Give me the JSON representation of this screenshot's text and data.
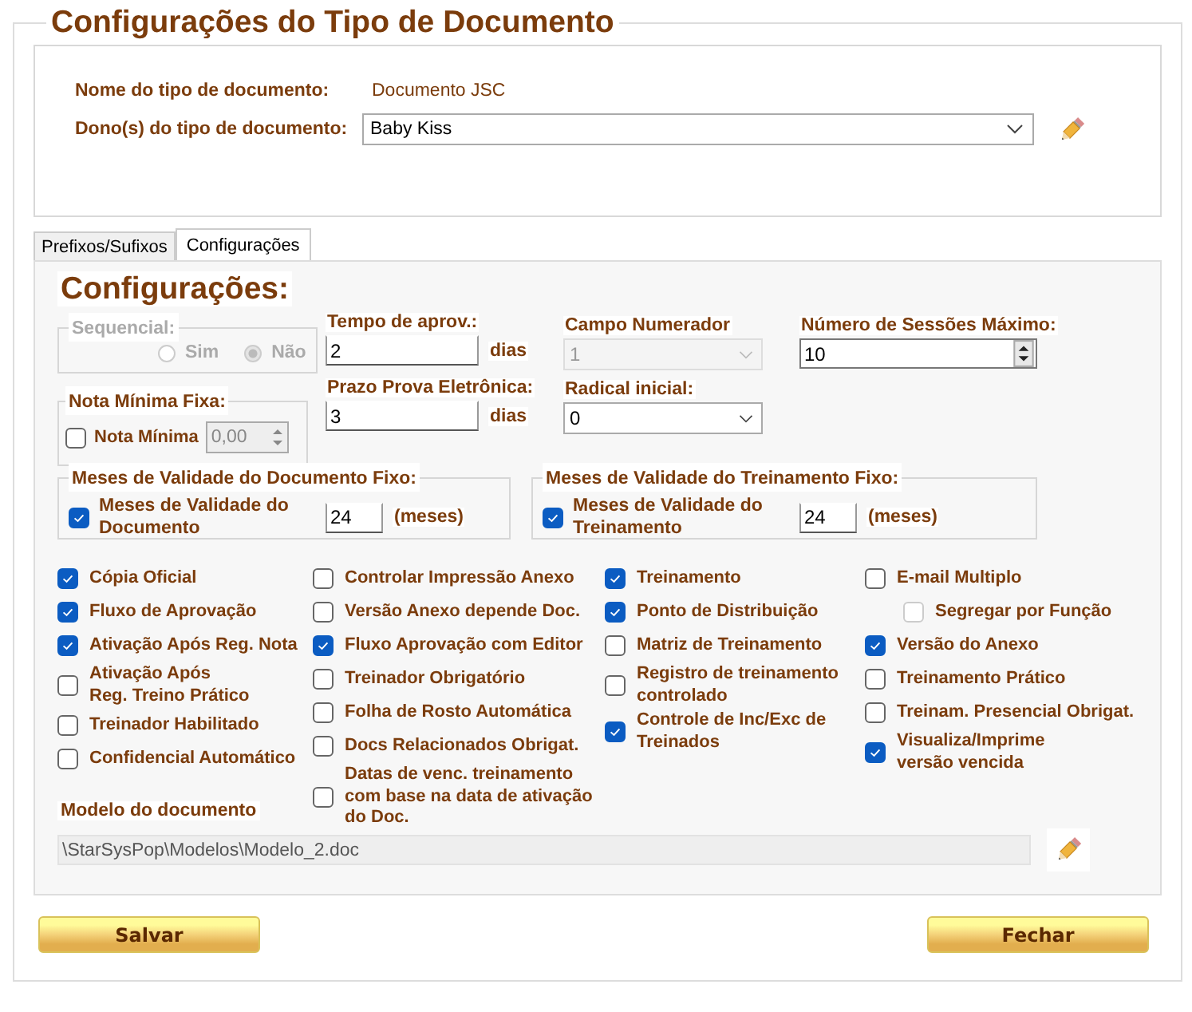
{
  "title": "Configurações do Tipo de Documento",
  "header": {
    "name_label": "Nome do tipo de documento:",
    "name_value": "Documento JSC",
    "owner_label": "Dono(s) do tipo de documento:",
    "owner_value": "Baby Kiss"
  },
  "tabs": [
    {
      "label": "Prefixos/Sufixos",
      "selected": false
    },
    {
      "label": "Configurações",
      "selected": true
    }
  ],
  "section_title": "Configurações:",
  "sequencial": {
    "legend": "Sequencial:",
    "disabled": true,
    "options": [
      {
        "label": "Sim",
        "selected": false
      },
      {
        "label": "Não",
        "selected": true
      }
    ]
  },
  "nota_minima": {
    "legend": "Nota Mínima Fixa:",
    "label": "Nota Mínima",
    "checked": false,
    "value": "0,00"
  },
  "tempo_aprov": {
    "label": "Tempo de aprov.:",
    "value": "2",
    "unit": "dias"
  },
  "prazo_prova": {
    "label": "Prazo Prova Eletrônica:",
    "value": "3",
    "unit": "dias"
  },
  "campo_numerador": {
    "label": "Campo Numerador",
    "value": "1",
    "disabled": true
  },
  "radical_inicial": {
    "label": "Radical inicial:",
    "value": "0",
    "disabled": false
  },
  "numero_sessoes": {
    "label": "Número de Sessões Máximo:",
    "value": "10"
  },
  "validity_groups": [
    {
      "legend": "Meses de Validade do Documento Fixo:",
      "label": "Meses de Validade do\nDocumento",
      "checked": true,
      "value": "24",
      "unit": "(meses)"
    },
    {
      "legend": "Meses de Validade do Treinamento Fixo:",
      "label": "Meses de Validade do\nTreinamento",
      "checked": true,
      "value": "24",
      "unit": "(meses)"
    }
  ],
  "option_columns": [
    [
      {
        "label": "Cópia Oficial",
        "checked": true
      },
      {
        "label": "Fluxo de Aprovação",
        "checked": true
      },
      {
        "label": "Ativação Após Reg. Nota",
        "checked": true
      },
      {
        "label": "Ativação Após\nReg. Treino Prático",
        "checked": false
      },
      {
        "label": "Treinador Habilitado",
        "checked": false
      },
      {
        "label": "Confidencial Automático",
        "checked": false
      }
    ],
    [
      {
        "label": "Controlar Impressão Anexo",
        "checked": false
      },
      {
        "label": "Versão Anexo depende Doc.",
        "checked": false
      },
      {
        "label": "Fluxo Aprovação com Editor",
        "checked": true
      },
      {
        "label": "Treinador Obrigatório",
        "checked": false
      },
      {
        "label": "Folha de Rosto Automática",
        "checked": false
      },
      {
        "label": "Docs Relacionados Obrigat.",
        "checked": false
      },
      {
        "label": "Datas de venc. treinamento\ncom base na data de ativação\ndo Doc.",
        "checked": false
      }
    ],
    [
      {
        "label": "Treinamento",
        "checked": true
      },
      {
        "label": "Ponto de Distribuição",
        "checked": true
      },
      {
        "label": "Matriz de Treinamento",
        "checked": false
      },
      {
        "label": "Registro de treinamento\ncontrolado",
        "checked": false
      },
      {
        "label": "Controle de Inc/Exc de\nTreinados",
        "checked": true
      }
    ],
    [
      {
        "label": "E-mail Multiplo",
        "checked": false,
        "children": [
          {
            "label": "Segregar por Função",
            "checked": false,
            "disabled": true
          }
        ]
      },
      {
        "label": "Versão do Anexo",
        "checked": true
      },
      {
        "label": "Treinamento Prático",
        "checked": false
      },
      {
        "label": "Treinam. Presencial Obrigat.",
        "checked": false
      },
      {
        "label": "Visualiza/Imprime\n versão vencida",
        "checked": true
      }
    ]
  ],
  "model": {
    "label": "Modelo do documento",
    "value": "\\StarSysPop\\Modelos\\Modelo_2.doc"
  },
  "buttons": [
    "Salvar",
    "Fechar"
  ]
}
